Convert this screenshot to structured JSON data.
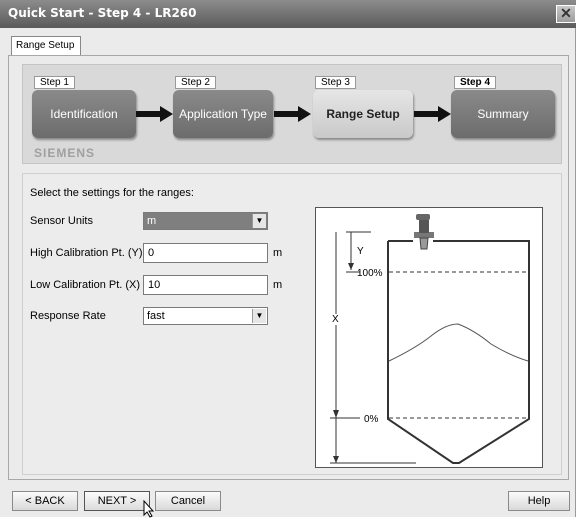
{
  "window": {
    "title": "Quick Start - Step 4 - LR260",
    "close_glyph": "✕"
  },
  "tab": {
    "label": "Range Setup"
  },
  "wizard": {
    "steps": [
      {
        "tag": "Step 1",
        "label": "Identification"
      },
      {
        "tag": "Step 2",
        "label": "Application Type"
      },
      {
        "tag": "Step 3",
        "label": "Range Setup"
      },
      {
        "tag": "Step 4",
        "label": "Summary"
      }
    ],
    "brand": "SIEMENS"
  },
  "form": {
    "heading": "Select the settings for the ranges:",
    "sensor_units": {
      "label": "Sensor Units",
      "value": "m"
    },
    "high_cal": {
      "label": "High Calibration Pt. (Y)",
      "value": "0",
      "unit": "m"
    },
    "low_cal": {
      "label": "Low Calibration Pt. (X)",
      "value": "10",
      "unit": "m"
    },
    "response_rate": {
      "label": "Response Rate",
      "value": "fast"
    }
  },
  "diagram": {
    "y_label": "Y",
    "x_label": "X",
    "pct_100": "100%",
    "pct_0": "0%"
  },
  "buttons": {
    "back": "< BACK",
    "next": "NEXT >",
    "cancel": "Cancel",
    "help": "Help"
  }
}
